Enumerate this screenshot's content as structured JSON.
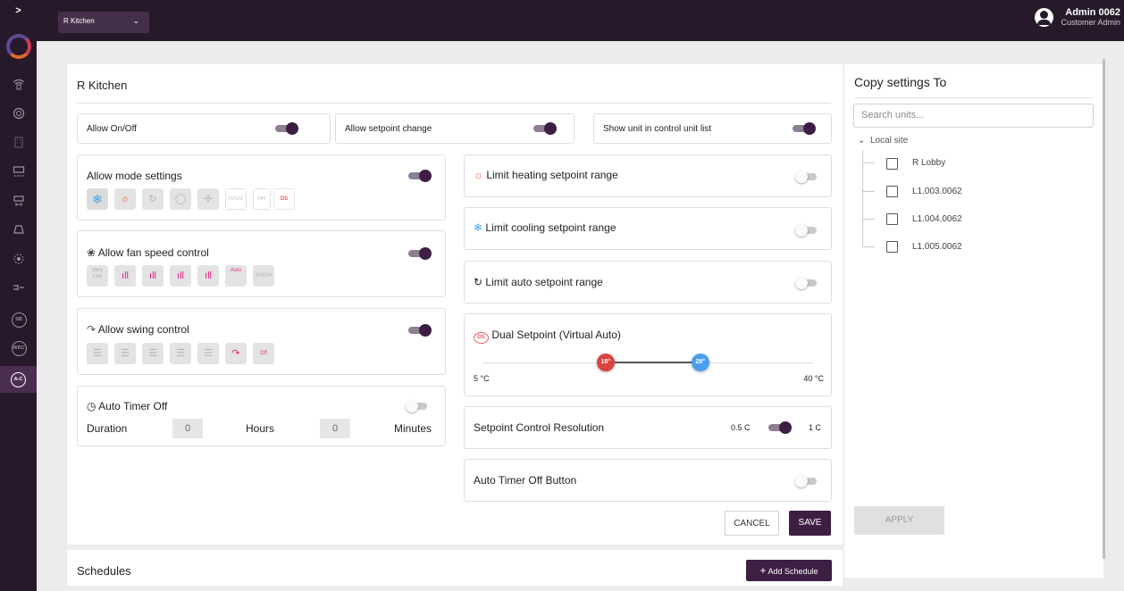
{
  "nav": {
    "expand": ">",
    "site": "R Kitchen",
    "user_name": "Admin 0062",
    "user_role": "Customer Admin"
  },
  "rail_icons": [
    "wifi-icon",
    "globe-icon",
    "building-icon",
    "ac-unit-icon",
    "fan-coil-icon",
    "car-icon",
    "sensor-icon",
    "connector-icon",
    "sb-icon",
    "wrc-icon",
    "ac-icon"
  ],
  "rail_labels": {
    "sb": "SB",
    "wrc": "WRC",
    "ac": "A-C"
  },
  "main": {
    "title": "R Kitchen",
    "allow_onoff": "Allow On/Off",
    "allow_setpoint": "Allow setpoint change",
    "show_unit": "Show unit in control unit list",
    "mode": {
      "label": "Allow mode settings",
      "haux": "HAUX",
      "hh": "HH",
      "ds": "DS"
    },
    "fan": {
      "label": "Allow fan speed control",
      "very_low": "Very Low",
      "auto": "Auto",
      "shigh": "SHIGH"
    },
    "swing": {
      "label": "Allow swing control",
      "off": "Off"
    },
    "timer": {
      "label": "Auto Timer Off",
      "duration": "Duration",
      "hours_val": "0",
      "hours": "Hours",
      "minutes_val": "0",
      "minutes": "Minutes"
    },
    "limit_heating": "Limit heating setpoint range",
    "limit_cooling": "Limit cooling setpoint range",
    "limit_auto": "Limit auto setpoint range",
    "dual": {
      "label": "Dual Setpoint (Virtual Auto)",
      "ds": "DS",
      "low": "18°",
      "high": "28°",
      "min": "5 °C",
      "max": "40 °C",
      "min_value": 5,
      "max_value": 40,
      "low_value": 18,
      "high_value": 28
    },
    "resolution": {
      "label": "Setpoint Control Resolution",
      "left": "0.5 C",
      "right": "1 C"
    },
    "auto_timer_button": "Auto Timer Off Button",
    "cancel": "CANCEL",
    "save": "SAVE"
  },
  "schedules": {
    "title": "Schedules",
    "add": "Add Schedule",
    "plus": "+"
  },
  "copy": {
    "title": "Copy settings To",
    "search_placeholder": "Search units...",
    "local_site": "Local site",
    "units": [
      "R Lobby",
      "L1.003.0062",
      "L1.004.0062",
      "L1.005.0062"
    ],
    "apply": "APPLY"
  },
  "colors": {
    "brand": "#3d1f44",
    "topbar": "#261a2a",
    "heat": "#d9443f",
    "cool": "#4a9ef0"
  }
}
